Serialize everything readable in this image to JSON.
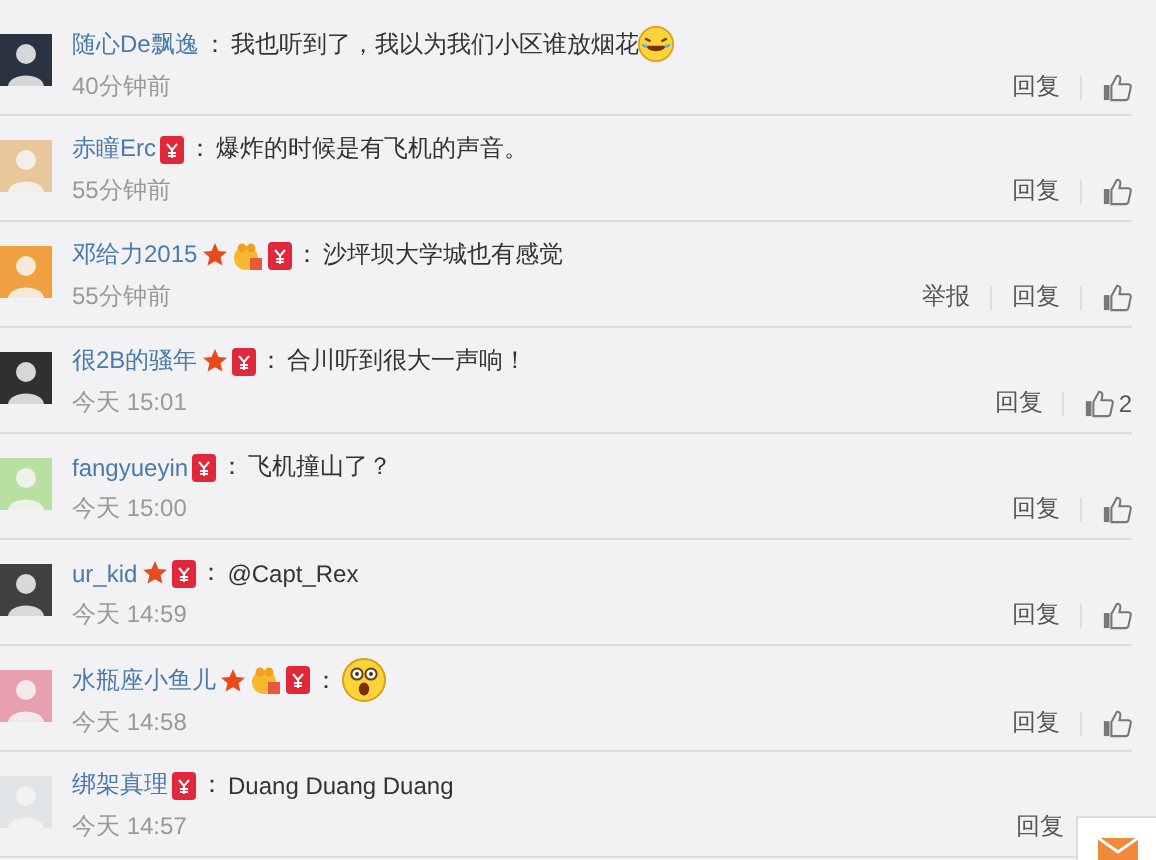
{
  "comments": [
    {
      "author": "随心De飘逸",
      "text": "我也听到了，我以为我们小区谁放烟花",
      "emoji": {
        "kind": "laughing"
      },
      "time": "40分钟前",
      "actions": [
        {
          "kind": "reply",
          "label": "回复"
        },
        {
          "kind": "like"
        }
      ]
    },
    {
      "author": "赤瞳Erc",
      "badges": [
        {
          "kind": "hongbao"
        }
      ],
      "text": "爆炸的时候是有飞机的声音。",
      "time": "55分钟前",
      "actions": [
        {
          "kind": "reply",
          "label": "回复"
        },
        {
          "kind": "like"
        }
      ]
    },
    {
      "author": "邓给力2015",
      "badges": [
        {
          "kind": "star"
        },
        {
          "kind": "member"
        },
        {
          "kind": "hongbao"
        }
      ],
      "text": "沙坪坝大学城也有感觉",
      "time": "55分钟前",
      "actions": [
        {
          "kind": "report",
          "label": "举报"
        },
        {
          "kind": "reply",
          "label": "回复"
        },
        {
          "kind": "like"
        }
      ]
    },
    {
      "author": "很2B的骚年",
      "badges": [
        {
          "kind": "star"
        },
        {
          "kind": "hongbao"
        }
      ],
      "text": "合川听到很大一声响！",
      "time": "今天 15:01",
      "actions": [
        {
          "kind": "reply",
          "label": "回复"
        },
        {
          "kind": "like",
          "count": "2"
        }
      ]
    },
    {
      "author": "fangyueyin",
      "badges": [
        {
          "kind": "hongbao"
        }
      ],
      "text": "飞机撞山了？",
      "time": "今天 15:00",
      "actions": [
        {
          "kind": "reply",
          "label": "回复"
        },
        {
          "kind": "like"
        }
      ]
    },
    {
      "author": "ur_kid",
      "badges": [
        {
          "kind": "star"
        },
        {
          "kind": "hongbao"
        }
      ],
      "text": "@Capt_Rex",
      "time": "今天 14:59",
      "actions": [
        {
          "kind": "reply",
          "label": "回复"
        },
        {
          "kind": "like"
        }
      ]
    },
    {
      "author": "水瓶座小鱼儿",
      "badges": [
        {
          "kind": "star"
        },
        {
          "kind": "member"
        },
        {
          "kind": "hongbao"
        }
      ],
      "emoji": {
        "kind": "surprised"
      },
      "time": "今天 14:58",
      "actions": [
        {
          "kind": "reply",
          "label": "回复"
        },
        {
          "kind": "like"
        }
      ]
    },
    {
      "author": "绑架真理",
      "badges": [
        {
          "kind": "hongbao"
        }
      ],
      "text": "Duang Duang Duang",
      "time": "今天 14:57",
      "actions": [
        {
          "kind": "reply",
          "label": "回复"
        }
      ]
    }
  ],
  "separator": "：",
  "message_widget": true
}
